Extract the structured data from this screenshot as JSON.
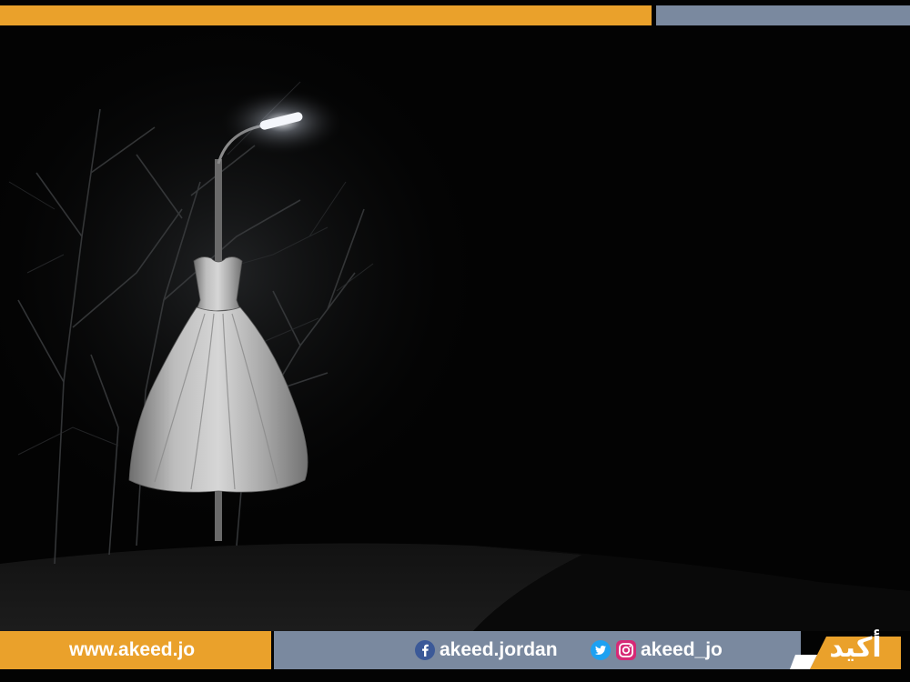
{
  "footer": {
    "website": "www.akeed.jo",
    "facebook_handle": "akeed.jordan",
    "social_handle": "akeed_jo"
  },
  "logo": {
    "wordmark": "أكيد"
  },
  "colors": {
    "accent_orange": "#eaa12b",
    "accent_slate": "#7a899f",
    "background": "#030303"
  },
  "icons": [
    "facebook-icon",
    "twitter-icon",
    "instagram-icon"
  ]
}
